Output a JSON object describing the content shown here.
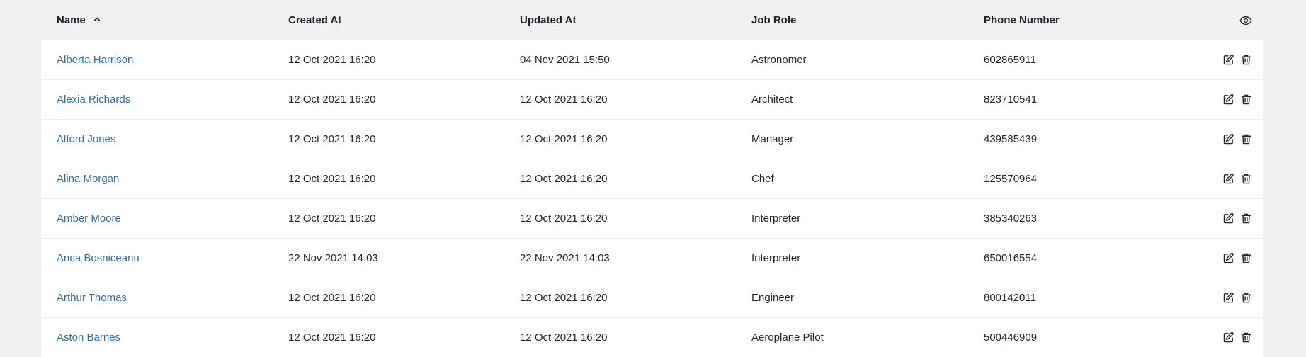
{
  "table": {
    "columns": {
      "name": "Name",
      "created_at": "Created At",
      "updated_at": "Updated At",
      "job_role": "Job Role",
      "phone_number": "Phone Number"
    },
    "sort": {
      "column": "name",
      "direction": "ascending",
      "icon": "chevron-up-icon"
    },
    "header_action_icon": "eye-icon",
    "row_action_icons": [
      "edit-icon",
      "trash-icon"
    ],
    "link_color": "#2f6ea3",
    "rows": [
      {
        "name": "Alberta Harrison",
        "created_at": "12 Oct 2021 16:20",
        "updated_at": "04 Nov 2021 15:50",
        "job_role": "Astronomer",
        "phone_number": "602865911"
      },
      {
        "name": "Alexia Richards",
        "created_at": "12 Oct 2021 16:20",
        "updated_at": "12 Oct 2021 16:20",
        "job_role": "Architect",
        "phone_number": "823710541"
      },
      {
        "name": "Alford Jones",
        "created_at": "12 Oct 2021 16:20",
        "updated_at": "12 Oct 2021 16:20",
        "job_role": "Manager",
        "phone_number": "439585439"
      },
      {
        "name": "Alina Morgan",
        "created_at": "12 Oct 2021 16:20",
        "updated_at": "12 Oct 2021 16:20",
        "job_role": "Chef",
        "phone_number": "125570964"
      },
      {
        "name": "Amber Moore",
        "created_at": "12 Oct 2021 16:20",
        "updated_at": "12 Oct 2021 16:20",
        "job_role": "Interpreter",
        "phone_number": "385340263"
      },
      {
        "name": "Anca Bosniceanu",
        "created_at": "22 Nov 2021 14:03",
        "updated_at": "22 Nov 2021 14:03",
        "job_role": "Interpreter",
        "phone_number": "650016554"
      },
      {
        "name": "Arthur Thomas",
        "created_at": "12 Oct 2021 16:20",
        "updated_at": "12 Oct 2021 16:20",
        "job_role": "Engineer",
        "phone_number": "800142011"
      },
      {
        "name": "Aston Barnes",
        "created_at": "12 Oct 2021 16:20",
        "updated_at": "12 Oct 2021 16:20",
        "job_role": "Aeroplane Pilot",
        "phone_number": "500446909"
      }
    ]
  }
}
